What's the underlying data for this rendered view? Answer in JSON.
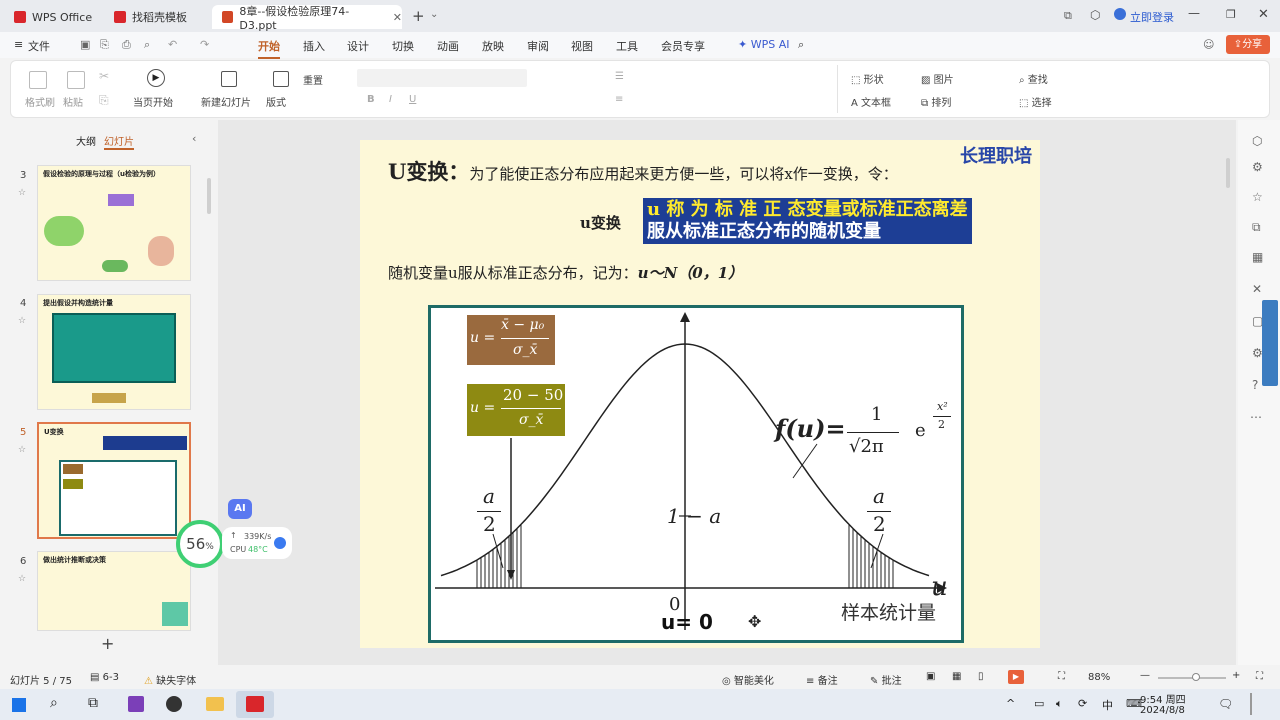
{
  "tabs": [
    {
      "label": "WPS Office",
      "color": "#d9262b"
    },
    {
      "label": "找稻壳模板",
      "color": "#d9262b"
    },
    {
      "label": "8章--假设检验原理74-D3.ppt",
      "color": "#d24726"
    }
  ],
  "window": {
    "login": "立即登录",
    "share": "分享"
  },
  "menu": {
    "file": "文件",
    "items": [
      "开始",
      "插入",
      "设计",
      "切换",
      "动画",
      "放映",
      "审阅",
      "视图",
      "工具",
      "会员专享"
    ],
    "active": "开始",
    "ai": "WPS AI"
  },
  "ribbon": {
    "format_painter": "格式刷",
    "paste": "粘贴",
    "from_start": "当页开始",
    "new_slide": "新建幻灯片",
    "layout": "版式",
    "reset": "重置",
    "shape": "形状",
    "image": "图片",
    "textbox": "文本框",
    "arrange": "排列",
    "find": "查找",
    "select": "选择"
  },
  "panel": {
    "tab_outline": "大纲",
    "tab_slides": "幻灯片",
    "thumbs": [
      {
        "num": "3",
        "title": "假设检验的原理与过程（u检验为例）"
      },
      {
        "num": "4",
        "title": "提出假设并构造统计量"
      },
      {
        "num": "5",
        "title": "U变换"
      },
      {
        "num": "6",
        "title": "做出统计推断或决策"
      }
    ]
  },
  "widget": {
    "percent": "56",
    "pct_sign": "%",
    "net": "339K/s",
    "cpu_label": "CPU",
    "cpu_val": "48°C",
    "ai": "AI"
  },
  "slide": {
    "watermark": "长理职培",
    "heading_bold": "U变换：",
    "heading_text": "为了能使正态分布应用起来更方便一些，可以将x作一变换，令：",
    "u_transform": "u变换",
    "highlight_line1": "u 称 为 标 准 正 态变量或标准正态离差",
    "highlight_line2": "服从标准正态分布的随机变量",
    "dist_line": "随机变量u服从标准正态分布，记为：",
    "dist_notation": "u～N（0，1）",
    "formula1_lhs": "u =",
    "formula1_num": "x̄ − μ₀",
    "formula1_den": "σ_x̄",
    "formula2_lhs": "u =",
    "formula2_num": "20 − 50",
    "formula2_den": "σ_x̄",
    "fu": "f(u)=",
    "fu_num": "1",
    "fu_den": "√2π",
    "fu_exp_e": "e",
    "fu_exp_num": "x²",
    "fu_exp_den": "2",
    "alpha_left_num": "a",
    "alpha_left_den": "2",
    "alpha_right_num": "a",
    "alpha_right_den": "2",
    "center_label": "1 − a",
    "axis_label": "u",
    "zero": "0",
    "u_zero": "u= 0",
    "sample_stat": "样本统计量"
  },
  "status": {
    "slide_count": "幻灯片 5 / 75",
    "section": "6-3",
    "missing_font": "缺失字体",
    "beautify": "智能美化",
    "notes": "备注",
    "comments": "批注",
    "zoom": "88%"
  },
  "taskbar": {
    "time": "9:54 周四",
    "date": "2024/8/8",
    "ime": "中"
  }
}
